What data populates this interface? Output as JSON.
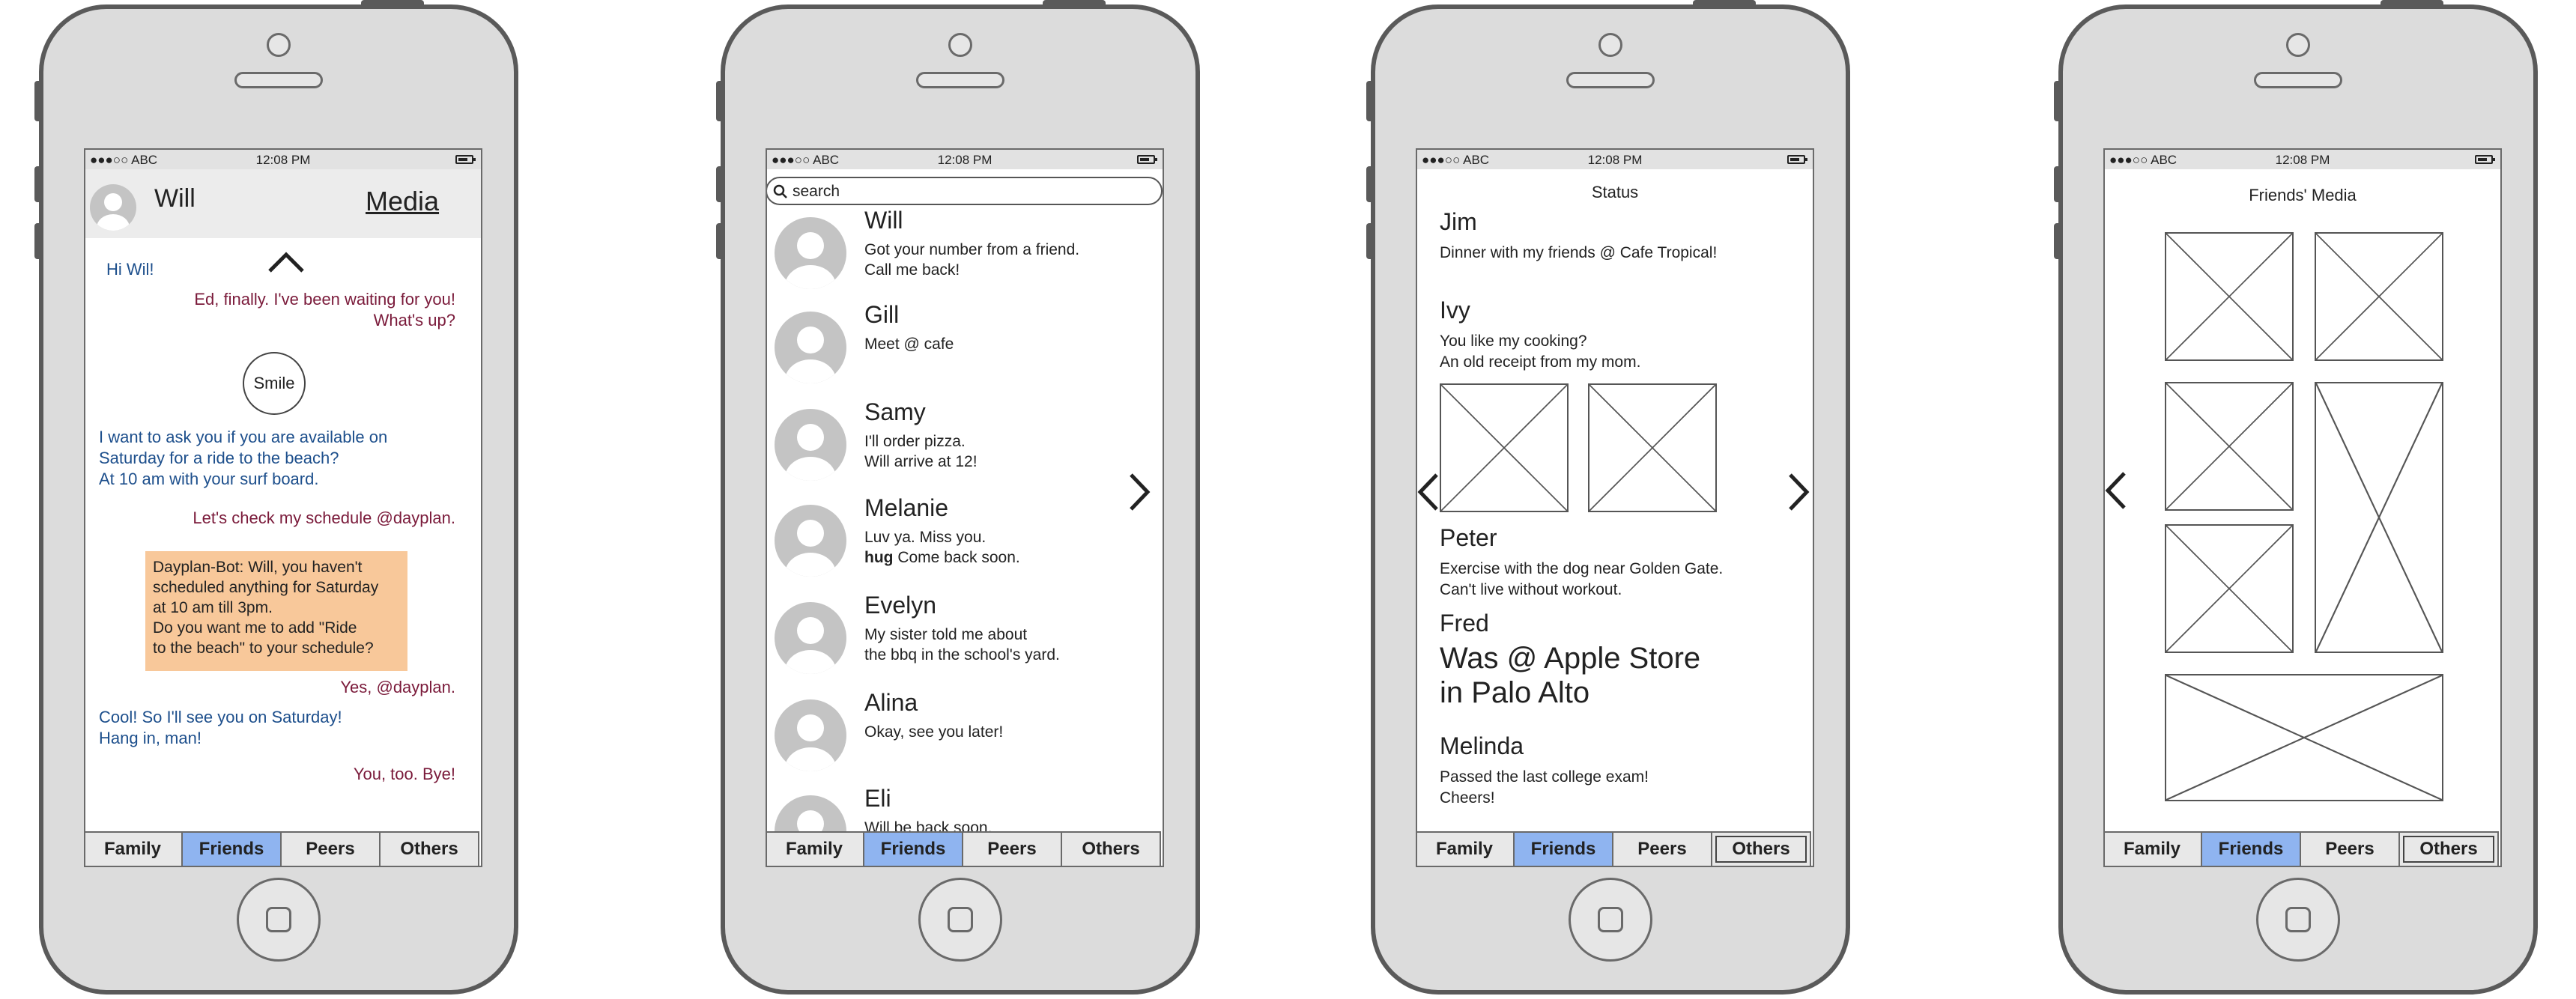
{
  "status_bar": {
    "carrier": "●●●○○ ABC",
    "time": "12:08 PM"
  },
  "tabs": [
    "Family",
    "Friends",
    "Peers",
    "Others"
  ],
  "active_tab": "Friends",
  "colors": {
    "active_tab": "#8fb4f0",
    "bot_bubble": "#f8c89a",
    "incoming": "#1d4f8c",
    "outgoing": "#7a1a3a"
  },
  "chat": {
    "contact_name": "Will",
    "media_link": "Media",
    "messages": [
      {
        "from": "them",
        "text": "Hi Wil!"
      },
      {
        "from": "me",
        "lines": [
          "Ed, finally. I've been waiting for you!",
          "What's up?"
        ]
      },
      {
        "from": "emoji",
        "text": "Smile"
      },
      {
        "from": "them",
        "lines": [
          "I want to ask you if you are available on",
          "Saturday for a ride to the beach?",
          "At 10 am with your surf board."
        ]
      },
      {
        "from": "me",
        "text": "Let's check my schedule @dayplan."
      },
      {
        "from": "bot",
        "lines": [
          "Dayplan-Bot: Will, you haven't",
          "scheduled anything for Saturday",
          "at 10 am till 3pm.",
          "Do you want me to add \"Ride",
          "to the beach\" to your schedule?"
        ]
      },
      {
        "from": "me",
        "text": "Yes, @dayplan."
      },
      {
        "from": "them",
        "lines": [
          "Cool! So I'll see you on Saturday!",
          "Hang in, man!"
        ]
      },
      {
        "from": "me",
        "text": "You, too. Bye!"
      }
    ]
  },
  "contacts": {
    "search_placeholder": "search",
    "items": [
      {
        "name": "Will",
        "lines": [
          "Got your number from a friend.",
          "Call me back!"
        ]
      },
      {
        "name": "Gill",
        "lines": [
          "Meet @ cafe"
        ]
      },
      {
        "name": "Samy",
        "lines": [
          "I'll order pizza.",
          "Will arrive at 12!"
        ]
      },
      {
        "name": "Melanie",
        "lines": [
          "Luv ya. Miss you."
        ],
        "bold": "hug",
        "rest": " Come back soon."
      },
      {
        "name": "Evelyn",
        "lines": [
          "My sister told me about",
          "the bbq in the school's yard."
        ]
      },
      {
        "name": "Alina",
        "lines": [
          "Okay, see you later!"
        ]
      },
      {
        "name": "Eli",
        "lines": [
          "Will be back soon."
        ]
      }
    ]
  },
  "status_page": {
    "title": "Status",
    "entries": [
      {
        "name": "Jim",
        "lines": [
          "Dinner with my friends @ Cafe Tropical!"
        ]
      },
      {
        "name": "Ivy",
        "lines": [
          "You like my cooking?",
          "An old receipt from my mom."
        ]
      },
      {
        "name": "Peter",
        "lines": [
          "Exercise with the dog near Golden Gate.",
          "Can't live without workout."
        ]
      },
      {
        "name": "Fred",
        "big_lines": [
          "Was @ Apple Store",
          "in Palo Alto"
        ]
      },
      {
        "name": "Melinda",
        "lines": [
          "Passed the last college exam!",
          "Cheers!"
        ]
      }
    ]
  },
  "media_page": {
    "title": "Friends' Media"
  }
}
